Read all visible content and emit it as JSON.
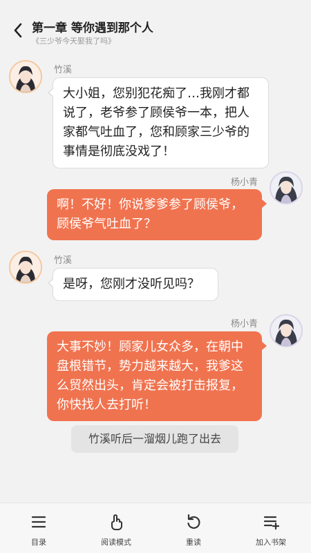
{
  "header": {
    "title": "第一章 等你遇到那个人",
    "subtitle": "《三少爷今天娶我了吗》"
  },
  "messages": [
    {
      "speaker": "竹溪",
      "side": "left",
      "text": "大小姐，您别犯花痴了…我刚才都说了，老爷参了顾侯爷一本，把人家都气吐血了，您和顾家三少爷的事情是彻底没戏了！"
    },
    {
      "speaker": "杨小青",
      "side": "right",
      "text": "啊！不好！你说爹爹参了顾侯爷，顾侯爷气吐血了？"
    },
    {
      "speaker": "竹溪",
      "side": "left",
      "text": "是呀，您刚才没听见吗？"
    },
    {
      "speaker": "杨小青",
      "side": "right",
      "text": "大事不妙！顾家儿女众多，在朝中盘根错节，势力越来越大，我爹这么贸然出头，肯定会被打击报复，你快找人去打听！"
    }
  ],
  "narration": "竹溪听后一溜烟儿跑了出去",
  "bottom_bar": {
    "tabs": [
      {
        "label": "目录",
        "icon": "menu-icon"
      },
      {
        "label": "阅读模式",
        "icon": "tap-hand-icon"
      },
      {
        "label": "重读",
        "icon": "replay-icon"
      },
      {
        "label": "加入书架",
        "icon": "add-bookshelf-icon"
      }
    ]
  },
  "colors": {
    "accent": "#f0734f",
    "background": "#f2f2f2",
    "bubble_left": "#ffffff"
  }
}
